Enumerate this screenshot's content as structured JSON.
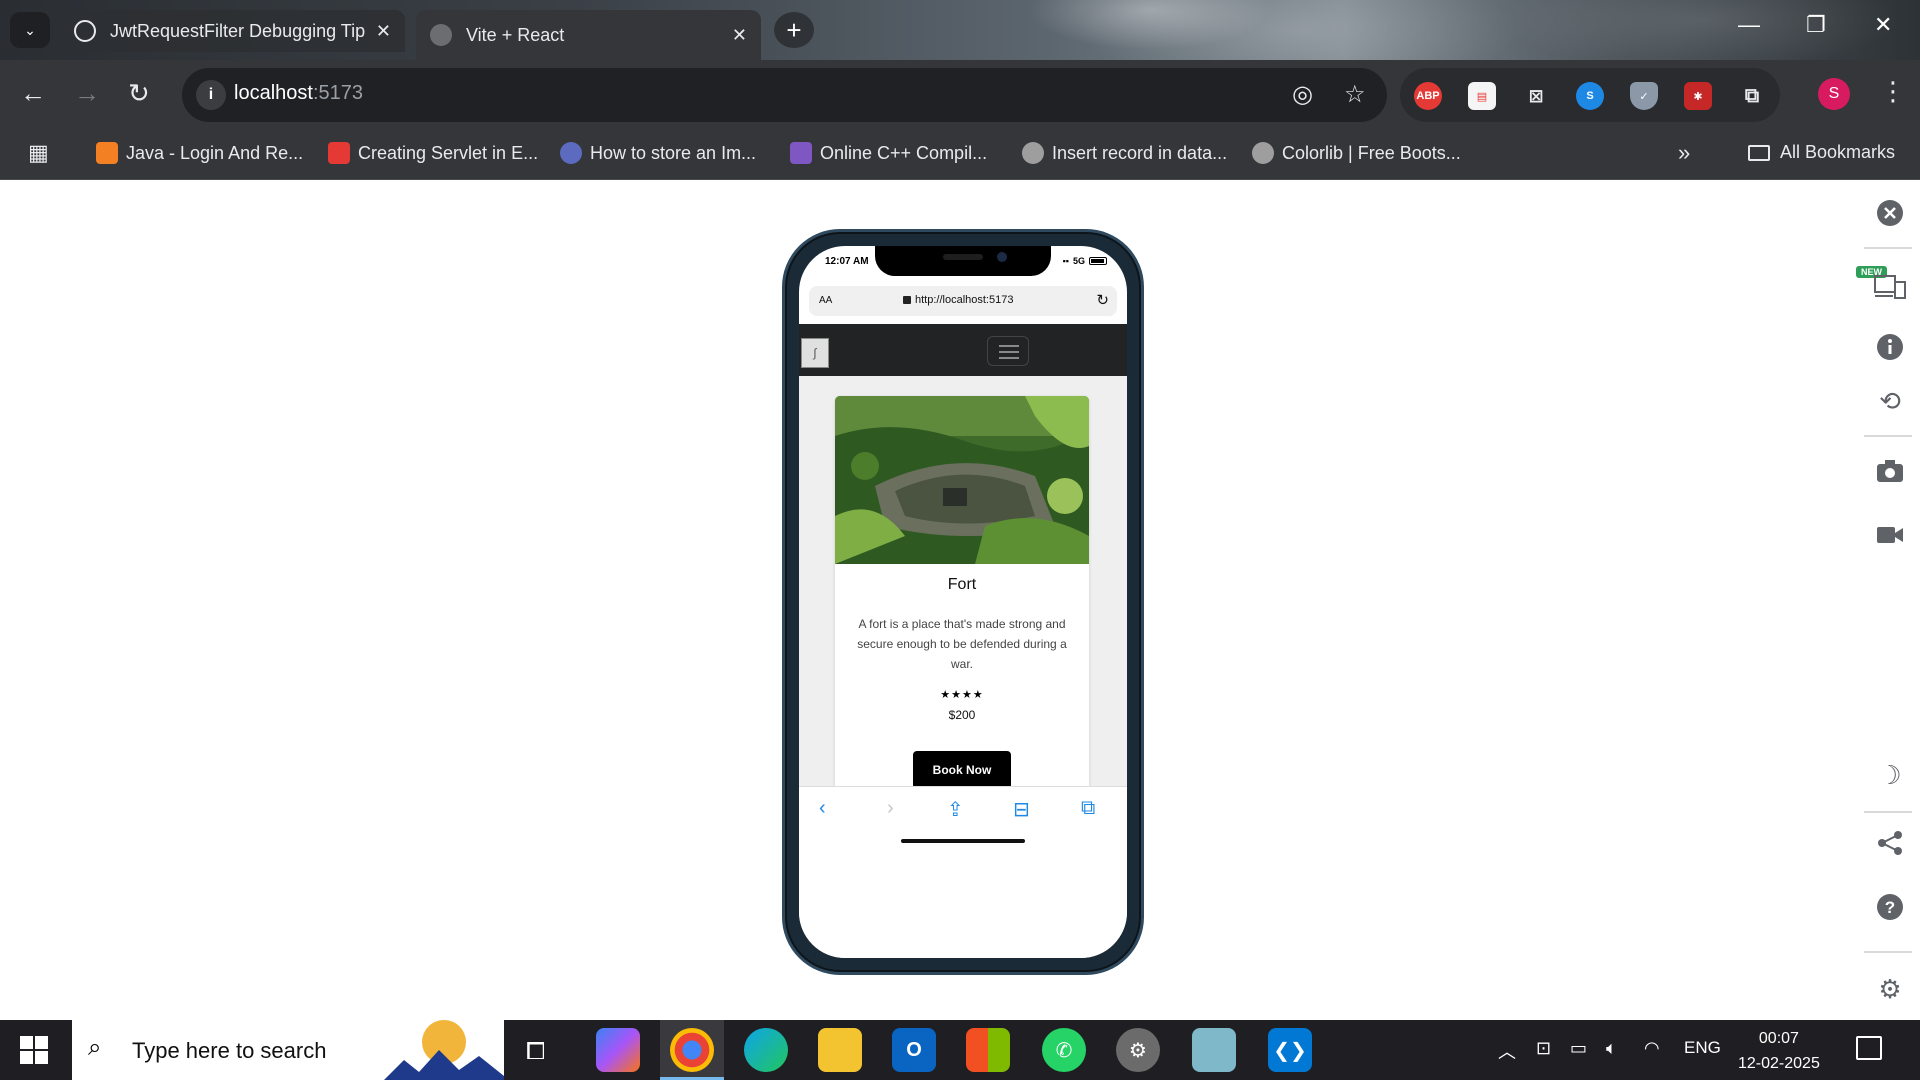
{
  "browser": {
    "tabs": [
      {
        "title": "JwtRequestFilter Debugging Tip",
        "active": false
      },
      {
        "title": "Vite + React",
        "active": true
      }
    ],
    "window_controls": {
      "minimize": "—",
      "restore": "❐",
      "close": "✕"
    },
    "address": {
      "host": "localhost",
      "port": ":5173"
    },
    "bookmarks": [
      {
        "label": "Java - Login And Re...",
        "color": "#f48024"
      },
      {
        "label": "Creating Servlet in E...",
        "color": "#e53935"
      },
      {
        "label": "How to store an Im...",
        "color": "#5c6bc0"
      },
      {
        "label": "Online C++ Compil...",
        "color": "#7e57c2"
      },
      {
        "label": "Insert record in data...",
        "color": "#9e9e9e"
      },
      {
        "label": "Colorlib | Free Boots...",
        "color": "#9e9e9e"
      }
    ],
    "all_bookmarks_label": "All Bookmarks",
    "profile_initial": "S",
    "extensions": [
      "ABP"
    ]
  },
  "phone": {
    "time": "12:07 AM",
    "network": "5G",
    "text_size_label": "AA",
    "url": "http://localhost:5173",
    "card": {
      "title": "Fort",
      "description": "A fort is a place that's made strong and secure enough to be defended during a war.",
      "stars": "★★★★",
      "price": "$200",
      "button": "Book Now"
    }
  },
  "sidebar_tools": {
    "new_badge": "NEW"
  },
  "taskbar": {
    "search_placeholder": "Type here to search",
    "language": "ENG",
    "time": "00:07",
    "date": "12-02-2025"
  },
  "colors": {
    "chrome_dark": "#35363a",
    "button_black": "#000000",
    "accent_blue": "#1e88e5"
  }
}
